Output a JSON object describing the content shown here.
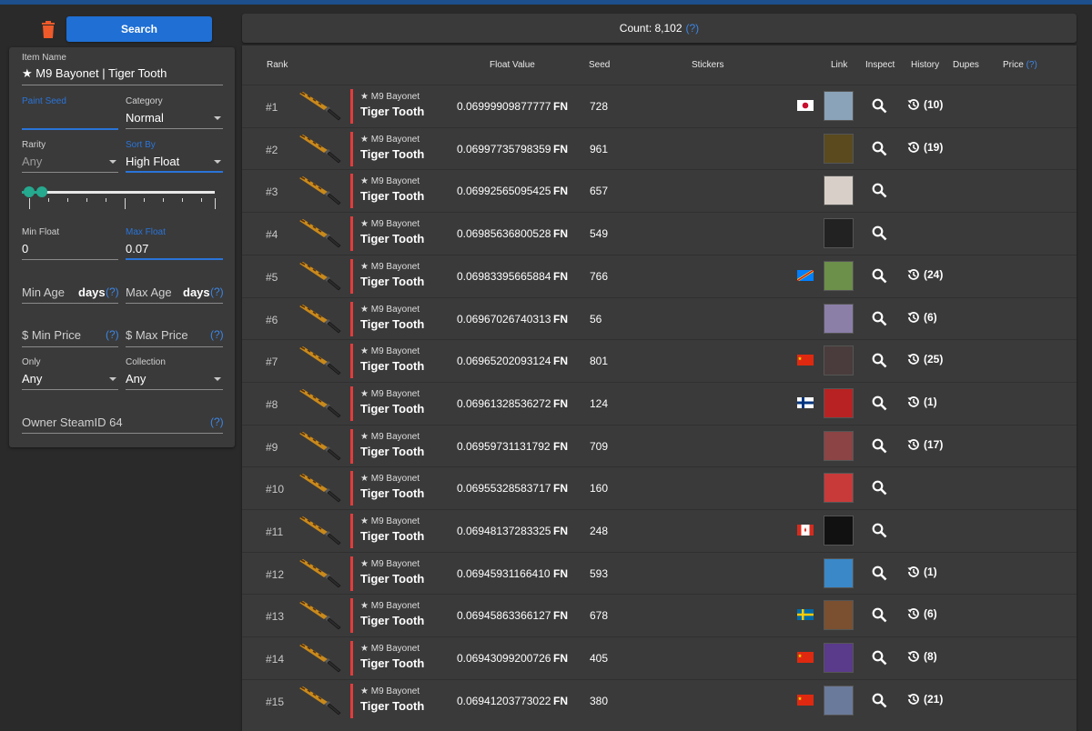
{
  "toolbar": {
    "search_label": "Search"
  },
  "filters": {
    "item_name": {
      "label": "Item Name",
      "value": "★ M9 Bayonet | Tiger Tooth"
    },
    "paint_seed": {
      "label": "Paint Seed"
    },
    "category": {
      "label": "Category",
      "value": "Normal"
    },
    "rarity": {
      "label": "Rarity",
      "value": "Any"
    },
    "sort_by": {
      "label": "Sort By",
      "value": "High Float"
    },
    "min_float": {
      "label": "Min Float",
      "value": "0"
    },
    "max_float": {
      "label": "Max Float",
      "value": "0.07"
    },
    "min_age": {
      "label": "Min Age",
      "suffix": "days",
      "help": "(?)"
    },
    "max_age": {
      "label": "Max Age",
      "suffix": "days",
      "help": "(?)"
    },
    "min_price": {
      "label": "$ Min Price",
      "help": "(?)"
    },
    "max_price": {
      "label": "$ Max Price",
      "help": "(?)"
    },
    "only": {
      "label": "Only",
      "value": "Any"
    },
    "collection": {
      "label": "Collection",
      "value": "Any"
    },
    "owner": {
      "label": "Owner SteamID 64",
      "help": "(?)"
    }
  },
  "results": {
    "count_label": "Count: 8,102",
    "count_help": "(?)",
    "columns": {
      "rank": "Rank",
      "float": "Float Value",
      "seed": "Seed",
      "stickers": "Stickers",
      "link": "Link",
      "inspect": "Inspect",
      "history": "History",
      "dupes": "Dupes",
      "price": "Price",
      "price_help": "(?)"
    },
    "rows": [
      {
        "rank": "#1",
        "weapon": "★ M9 Bayonet",
        "skin": "Tiger Tooth",
        "float": "0.06999909877777",
        "wear": "FN",
        "seed": "728",
        "flag": "jp",
        "avatar": "#8aa3b8",
        "history": "(10)"
      },
      {
        "rank": "#2",
        "weapon": "★ M9 Bayonet",
        "skin": "Tiger Tooth",
        "float": "0.06997735798359",
        "wear": "FN",
        "seed": "961",
        "flag": "",
        "avatar": "#5a4a1e",
        "history": "(19)"
      },
      {
        "rank": "#3",
        "weapon": "★ M9 Bayonet",
        "skin": "Tiger Tooth",
        "float": "0.06992565095425",
        "wear": "FN",
        "seed": "657",
        "flag": "",
        "avatar": "#d7cfc8",
        "history": ""
      },
      {
        "rank": "#4",
        "weapon": "★ M9 Bayonet",
        "skin": "Tiger Tooth",
        "float": "0.06985636800528",
        "wear": "FN",
        "seed": "549",
        "flag": "",
        "avatar": "#222222",
        "history": ""
      },
      {
        "rank": "#5",
        "weapon": "★ M9 Bayonet",
        "skin": "Tiger Tooth",
        "float": "0.06983395665884",
        "wear": "FN",
        "seed": "766",
        "flag": "cd",
        "avatar": "#6c8f4a",
        "history": "(24)"
      },
      {
        "rank": "#6",
        "weapon": "★ M9 Bayonet",
        "skin": "Tiger Tooth",
        "float": "0.06967026740313",
        "wear": "FN",
        "seed": "56",
        "flag": "",
        "avatar": "#8b7fa8",
        "history": "(6)"
      },
      {
        "rank": "#7",
        "weapon": "★ M9 Bayonet",
        "skin": "Tiger Tooth",
        "float": "0.06965202093124",
        "wear": "FN",
        "seed": "801",
        "flag": "cn",
        "avatar": "#4a3c3c",
        "history": "(25)"
      },
      {
        "rank": "#8",
        "weapon": "★ M9 Bayonet",
        "skin": "Tiger Tooth",
        "float": "0.06961328536272",
        "wear": "FN",
        "seed": "124",
        "flag": "fi",
        "avatar": "#b82222",
        "history": "(1)"
      },
      {
        "rank": "#9",
        "weapon": "★ M9 Bayonet",
        "skin": "Tiger Tooth",
        "float": "0.06959731131792",
        "wear": "FN",
        "seed": "709",
        "flag": "",
        "avatar": "#8c4444",
        "history": "(17)"
      },
      {
        "rank": "#10",
        "weapon": "★ M9 Bayonet",
        "skin": "Tiger Tooth",
        "float": "0.06955328583717",
        "wear": "FN",
        "seed": "160",
        "flag": "",
        "avatar": "#c83a3a",
        "history": ""
      },
      {
        "rank": "#11",
        "weapon": "★ M9 Bayonet",
        "skin": "Tiger Tooth",
        "float": "0.06948137283325",
        "wear": "FN",
        "seed": "248",
        "flag": "ca",
        "avatar": "#111111",
        "history": ""
      },
      {
        "rank": "#12",
        "weapon": "★ M9 Bayonet",
        "skin": "Tiger Tooth",
        "float": "0.06945931166410",
        "wear": "FN",
        "seed": "593",
        "flag": "",
        "avatar": "#3a88c8",
        "history": "(1)"
      },
      {
        "rank": "#13",
        "weapon": "★ M9 Bayonet",
        "skin": "Tiger Tooth",
        "float": "0.06945863366127",
        "wear": "FN",
        "seed": "678",
        "flag": "se",
        "avatar": "#7a5030",
        "history": "(6)"
      },
      {
        "rank": "#14",
        "weapon": "★ M9 Bayonet",
        "skin": "Tiger Tooth",
        "float": "0.06943099200726",
        "wear": "FN",
        "seed": "405",
        "flag": "cn",
        "avatar": "#5a3a8a",
        "history": "(8)"
      },
      {
        "rank": "#15",
        "weapon": "★ M9 Bayonet",
        "skin": "Tiger Tooth",
        "float": "0.06941203773022",
        "wear": "FN",
        "seed": "380",
        "flag": "cn",
        "avatar": "#6a7a9a",
        "history": "(21)"
      }
    ]
  }
}
